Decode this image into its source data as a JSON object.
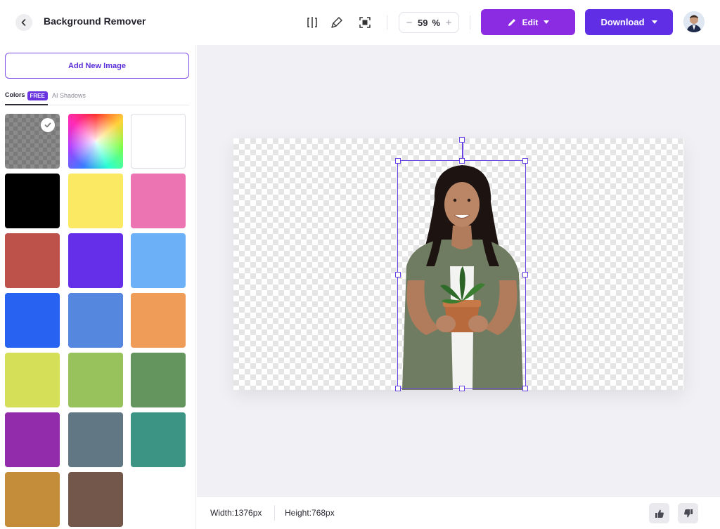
{
  "header": {
    "title": "Background Remover",
    "zoom": {
      "value": "59",
      "unit": "%",
      "minus": "−",
      "plus": "+"
    },
    "edit_label": "Edit",
    "download_label": "Download",
    "icons": [
      "back-icon",
      "compare-icon",
      "brush-icon",
      "fit-screen-icon",
      "pencil-icon",
      "caret-down-icon"
    ]
  },
  "sidebar": {
    "add_image_label": "Add New Image",
    "tabs": {
      "colors_label": "Colors",
      "free_badge": "FREE",
      "shadows_label": "AI Shadows"
    },
    "swatches": [
      {
        "name": "transparent",
        "color": "#8b8b8b",
        "selected": true
      },
      {
        "name": "color-picker",
        "color": "rainbow"
      },
      {
        "name": "white",
        "color": "#ffffff"
      },
      {
        "name": "black",
        "color": "#000000"
      },
      {
        "name": "yellow",
        "color": "#fbe964"
      },
      {
        "name": "pink",
        "color": "#ec74b2"
      },
      {
        "name": "red",
        "color": "#bc524a"
      },
      {
        "name": "violet",
        "color": "#652ee9"
      },
      {
        "name": "light-blue",
        "color": "#6cb1f7"
      },
      {
        "name": "blue",
        "color": "#2862f1"
      },
      {
        "name": "steel-blue",
        "color": "#5687de"
      },
      {
        "name": "orange",
        "color": "#f09c59"
      },
      {
        "name": "lime",
        "color": "#d5df57"
      },
      {
        "name": "green",
        "color": "#98c25c"
      },
      {
        "name": "forest-green",
        "color": "#64955f"
      },
      {
        "name": "purple",
        "color": "#922cab"
      },
      {
        "name": "slate",
        "color": "#617884"
      },
      {
        "name": "teal",
        "color": "#3c9584"
      },
      {
        "name": "mustard",
        "color": "#c48d3a"
      },
      {
        "name": "brown",
        "color": "#74574b"
      }
    ]
  },
  "footer": {
    "width_label": "Width:1376px",
    "height_label": "Height:768px"
  },
  "colors": {
    "edit_button": "#8b2be2",
    "download_button": "#5f2ee5",
    "selection": "#6b46e5"
  }
}
